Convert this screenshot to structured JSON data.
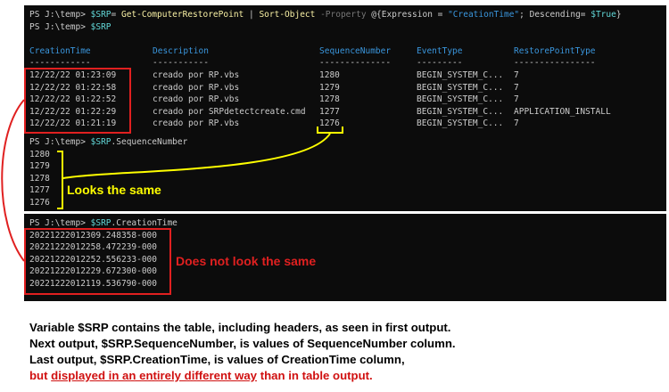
{
  "block1": {
    "prompt1": "PS J:\\temp> ",
    "var_srp": "$SRP",
    "eq": "= ",
    "cmdlet1": "Get-ComputerRestorePoint",
    "pipe": " | ",
    "cmdlet2": "Sort-Object",
    "param_property": " -Property ",
    "hash_open": "@{Expression = ",
    "str_creation": "\"CreationTime\"",
    "hash_mid": "; Descending= ",
    "var_true": "$True",
    "hash_close": "}",
    "prompt2": "PS J:\\temp> ",
    "var_srp2": "$SRP",
    "headers": [
      "CreationTime",
      "Description",
      "SequenceNumber",
      "EventType",
      "RestorePointType"
    ],
    "underlines": [
      "------------",
      "-----------",
      "--------------",
      "---------",
      "----------------"
    ],
    "rows": [
      {
        "time": "12/22/22 01:23:09",
        "desc": "creado por RP.vbs",
        "seq": "1280",
        "event": "BEGIN_SYSTEM_C...",
        "type": "7"
      },
      {
        "time": "12/22/22 01:22:58",
        "desc": "creado por RP.vbs",
        "seq": "1279",
        "event": "BEGIN_SYSTEM_C...",
        "type": "7"
      },
      {
        "time": "12/22/22 01:22:52",
        "desc": "creado por RP.vbs",
        "seq": "1278",
        "event": "BEGIN_SYSTEM_C...",
        "type": "7"
      },
      {
        "time": "12/22/22 01:22:29",
        "desc": "creado por SRPdetectcreate.cmd",
        "seq": "1277",
        "event": "BEGIN_SYSTEM_C...",
        "type": "APPLICATION_INSTALL"
      },
      {
        "time": "12/22/22 01:21:19",
        "desc": "creado por RP.vbs",
        "seq": "1276",
        "event": "BEGIN_SYSTEM_C...",
        "type": "7"
      }
    ]
  },
  "block2": {
    "prompt": "PS J:\\temp> ",
    "var": "$SRP",
    "prop": ".SequenceNumber",
    "values": [
      "1280",
      "1279",
      "1278",
      "1277",
      "1276"
    ],
    "note": "Looks the same"
  },
  "block3": {
    "prompt": "PS J:\\temp> ",
    "var": "$SRP",
    "prop": ".CreationTime",
    "values": [
      "20221222012309.248358-000",
      "20221222012258.472239-000",
      "20221222012252.556233-000",
      "20221222012229.672300-000",
      "20221222012119.536790-000"
    ],
    "note": "Does not look the same"
  },
  "caption": {
    "line1": "Variable $SRP contains the table, including headers, as seen in first output.",
    "line2": "Next output, $SRP.SequenceNumber, is values of SequenceNumber column.",
    "line3": "Last output, $SRP.CreationTime, is values of CreationTime column,",
    "line4_a": "but ",
    "line4_b": "displayed in an entirely different way",
    "line4_c": " than in table output."
  },
  "colors": {
    "terminal_bg": "#0c0c0c",
    "terminal_text": "#cccccc",
    "annotation_red": "#e02020",
    "annotation_yellow": "#ffff00"
  }
}
